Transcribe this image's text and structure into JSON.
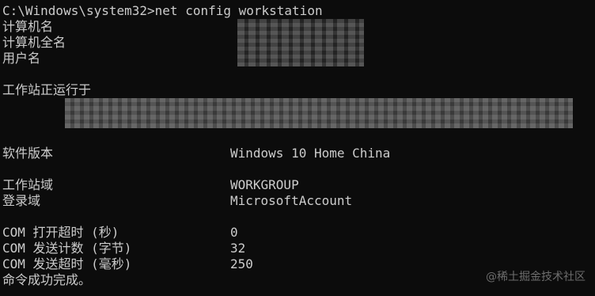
{
  "console": {
    "prompt": "C:\\Windows\\system32>net config workstation",
    "labels": {
      "computer_name": "计算机名",
      "full_computer_name": "计算机全名",
      "user_name": "用户名",
      "workstation_running_on": "工作站正运行于",
      "software_version": "软件版本",
      "workstation_domain": "工作站域",
      "logon_domain": "登录域",
      "com_open_timeout": "COM 打开超时 (秒)",
      "com_send_count": "COM 发送计数 (字节)",
      "com_send_timeout": "COM 发送超时 (毫秒)",
      "completed": "命令成功完成。"
    },
    "values": {
      "software_version": "Windows 10 Home China",
      "workstation_domain": "WORKGROUP",
      "logon_domain": "MicrosoftAccount",
      "com_open_timeout": "0",
      "com_send_count": "32",
      "com_send_timeout": "250"
    }
  },
  "watermark": "@稀土掘金技术社区",
  "colors": {
    "background": "#0c0c0c",
    "text": "#cccccc",
    "watermark": "#6d6d6d"
  }
}
